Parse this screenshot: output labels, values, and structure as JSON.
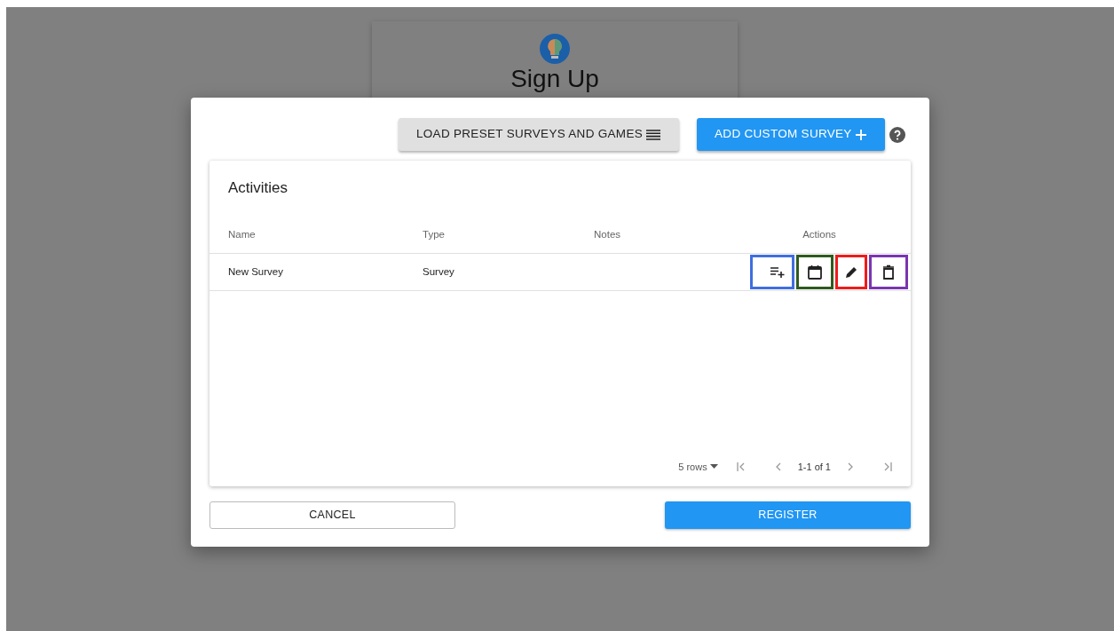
{
  "background": {
    "title": "Sign Up"
  },
  "toolbar": {
    "buttons": [
      {
        "label": "LOAD PRESET SURVEYS AND GAMES",
        "kind": "secondary"
      },
      {
        "label": "ADD CUSTOM SURVEY",
        "kind": "primary"
      }
    ]
  },
  "activities": {
    "title": "Activities",
    "columns": [
      "Name",
      "Type",
      "Notes",
      "Actions"
    ],
    "rows": [
      {
        "name": "New Survey",
        "type": "Survey",
        "actions": [
          {
            "kind": "add-to-list",
            "color": "#3f6ee0"
          },
          {
            "kind": "schedule",
            "color": "#2f5a1f"
          },
          {
            "kind": "edit",
            "color": "#ee1c1c"
          },
          {
            "kind": "delete",
            "color": "#7a35b0"
          }
        ]
      }
    ]
  },
  "pagination": {
    "rows_per_page": "5 rows",
    "range": "1-1 of 1"
  },
  "footer": {
    "cancel": "CANCEL",
    "register": "REGISTER"
  }
}
